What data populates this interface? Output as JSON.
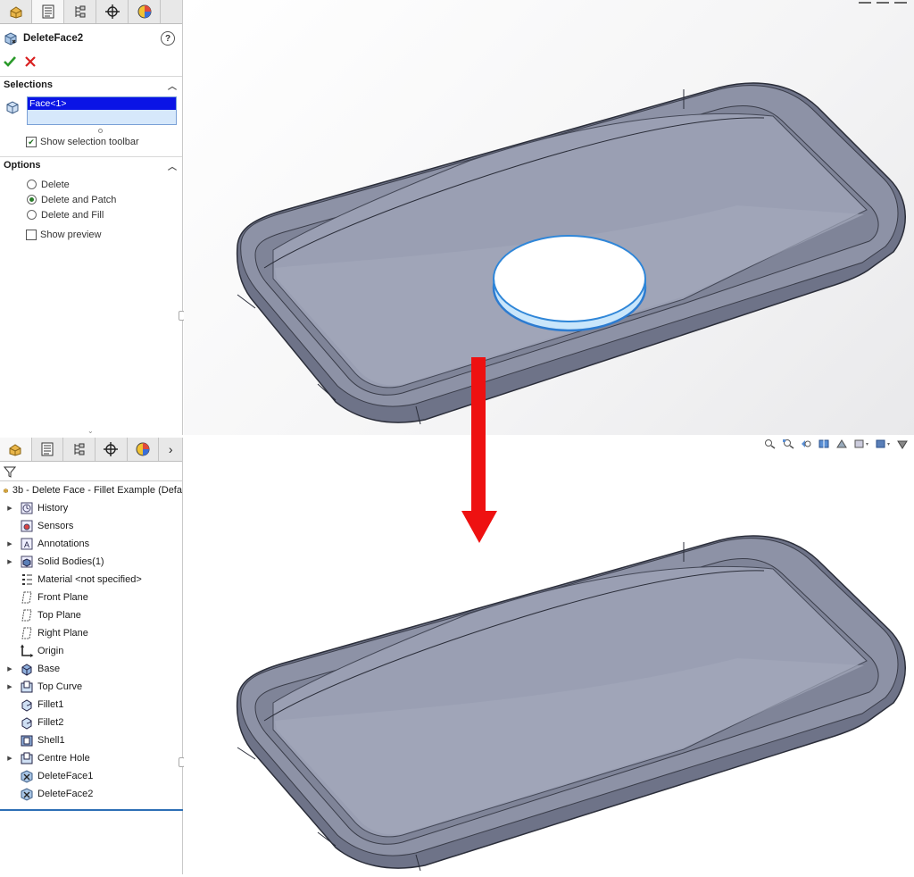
{
  "property_manager": {
    "feature_name": "DeleteFace2",
    "help_symbol": "?",
    "selections_header": "Selections",
    "selection_items": [
      "Face<1>"
    ],
    "show_selection_toolbar_label": "Show selection toolbar",
    "show_selection_toolbar_checked": true,
    "options_header": "Options",
    "options": [
      {
        "label": "Delete",
        "selected": false
      },
      {
        "label": "Delete and Patch",
        "selected": true
      },
      {
        "label": "Delete and Fill",
        "selected": false
      }
    ],
    "show_preview_label": "Show preview",
    "show_preview_checked": false
  },
  "feature_tree": {
    "root": "3b - Delete Face - Fillet Example (Defa",
    "items": [
      {
        "label": "History",
        "icon": "history-icon",
        "expandable": true
      },
      {
        "label": "Sensors",
        "icon": "sensor-icon",
        "expandable": false
      },
      {
        "label": "Annotations",
        "icon": "annotation-icon",
        "expandable": true
      },
      {
        "label": "Solid Bodies(1)",
        "icon": "solid-bodies-icon",
        "expandable": true
      },
      {
        "label": "Material <not specified>",
        "icon": "material-icon",
        "expandable": false
      },
      {
        "label": "Front Plane",
        "icon": "plane-icon",
        "expandable": false
      },
      {
        "label": "Top Plane",
        "icon": "plane-icon",
        "expandable": false
      },
      {
        "label": "Right Plane",
        "icon": "plane-icon",
        "expandable": false
      },
      {
        "label": "Origin",
        "icon": "origin-icon",
        "expandable": false
      },
      {
        "label": "Base",
        "icon": "extrude-icon",
        "expandable": true
      },
      {
        "label": "Top Curve",
        "icon": "cut-icon",
        "expandable": true
      },
      {
        "label": "Fillet1",
        "icon": "fillet-icon",
        "expandable": false
      },
      {
        "label": "Fillet2",
        "icon": "fillet-icon",
        "expandable": false
      },
      {
        "label": "Shell1",
        "icon": "shell-icon",
        "expandable": false
      },
      {
        "label": "Centre Hole",
        "icon": "cut-icon",
        "expandable": true
      },
      {
        "label": "DeleteFace1",
        "icon": "delete-face-icon",
        "expandable": false
      },
      {
        "label": "DeleteFace2",
        "icon": "delete-face-icon",
        "expandable": false
      }
    ]
  },
  "colors": {
    "selection_highlight": "#0a14e6",
    "model_gray": "#8a8fa3",
    "face_highlight": "#3aa0ea",
    "arrow": "#ee1111",
    "rollback_bar": "#2d6fb5"
  }
}
